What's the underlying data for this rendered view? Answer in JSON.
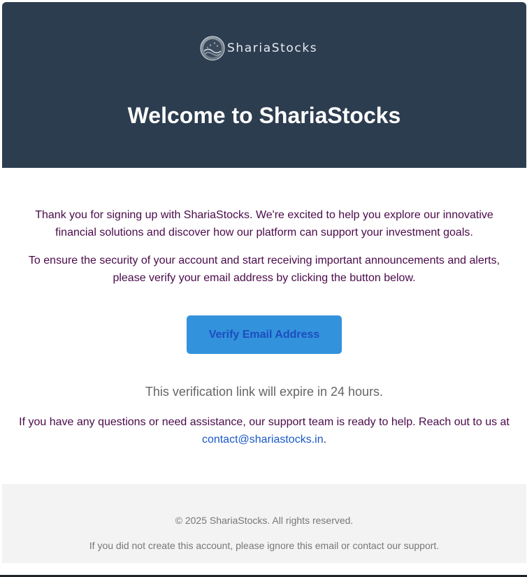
{
  "header": {
    "brand_name": "ShariaStocks",
    "logo_icon": "globe-stars-logo",
    "title": "Welcome to ShariaStocks",
    "background_color": "#2d3d50"
  },
  "body": {
    "intro": "Thank you for signing up with ShariaStocks. We're excited to help you explore our innovative financial solutions and discover how our platform can support your investment goals.",
    "instruction": "To ensure the security of your account and start receiving important announcements and alerts, please verify your email address by clicking the button below.",
    "verify_button_label": "Verify Email Address",
    "expiry_note": "This verification link will expire in 24 hours.",
    "support_text": "If you have any questions or need assistance, our support team is ready to help. Reach out to us at ",
    "support_email": "contact@shariastocks.in",
    "support_suffix": ".",
    "text_color": "#4a0a4a",
    "button_color": "#3392dc"
  },
  "footer": {
    "copyright": "© 2025 ShariaStocks. All rights reserved.",
    "note": "If you did not create this account, please ignore this email or contact our support."
  }
}
